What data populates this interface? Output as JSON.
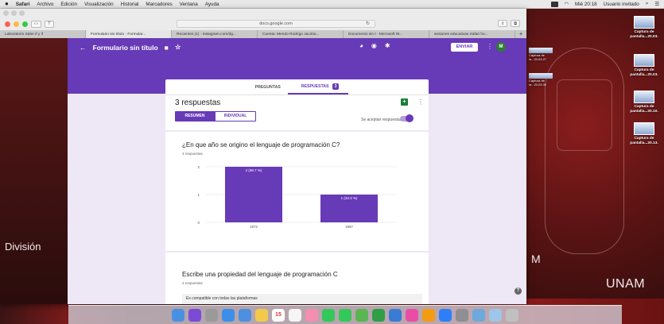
{
  "menubar": {
    "apple": "",
    "items": [
      "Safari",
      "Archivo",
      "Edición",
      "Visualización",
      "Historial",
      "Marcadores",
      "Ventana",
      "Ayuda"
    ],
    "clock": "Mié 20:18",
    "user": "Usuario invitado"
  },
  "background_window": {
    "tabs": [
      "Safari",
      "Archivo",
      "Edició"
    ]
  },
  "browser": {
    "url": "docs.google.com",
    "reload_icon": "reload-icon",
    "tabs": [
      "Laboratorio Sabe if y if",
      "Formulario sin título - Formular...",
      "Recientes (1) - instagram.com/dg...",
      "Cuenta: Mendo Rodrigo Jacinto...",
      "Documento sin t - Microsoft W...",
      "sesiones educativas Safari ho..."
    ]
  },
  "forms": {
    "title": "Formulario sin título",
    "send_label": "ENVIAR",
    "avatar_letter": "M",
    "tabs": {
      "questions": "PREGUNTAS",
      "responses": "RESPUESTAS",
      "responses_count": "3"
    },
    "responses_heading": "3 respuestas",
    "summary_label": "RESUMEN",
    "individual_label": "INDIVIDUAL",
    "accepting_label": "Se aceptan respuestas",
    "q1": {
      "title": "¿En que año se origino el lenguaje de programación C?",
      "subtitle": "3 respuestas"
    },
    "q2": {
      "title": "Escribe una propiedad del lenguaje de programación C",
      "subtitle": "3 respuestas",
      "answer_preview": "Es compatible con todas las plataformas"
    }
  },
  "chart_data": {
    "type": "bar",
    "categories": [
      "1972",
      "1987"
    ],
    "values": [
      2,
      1
    ],
    "data_labels": [
      "2 (66.7 %)",
      "1 (33.3 %)"
    ],
    "yticks": [
      "0",
      "1",
      "2"
    ],
    "ylim": [
      0,
      2
    ],
    "color": "#673ab7"
  },
  "desktop": {
    "left_text": "División",
    "right_text": "UNAM",
    "right_letter": "M",
    "files": [
      {
        "line1": "Captura de",
        "line2": "pantalla...20.03."
      },
      {
        "line1": "Captura de",
        "line2": "pantalla...20.03."
      },
      {
        "line1": "Captura de",
        "line2": "pantalla...20.10."
      },
      {
        "line1": "Captura de",
        "line2": "pantalla...20.13."
      }
    ],
    "small_files": [
      {
        "line1": "Captura de",
        "line2": "la...20.03.27"
      },
      {
        "line1": "Captura de",
        "line2": "la...20.03.30"
      }
    ]
  },
  "dock": {
    "icons": [
      "finder-icon",
      "siri-icon",
      "launchpad-icon",
      "safari-icon",
      "mail-icon",
      "notes-icon",
      "calendar-icon",
      "reminders-icon",
      "photos-icon",
      "messages-icon",
      "facetime-icon",
      "maps-icon",
      "numbers-icon",
      "keynote-icon",
      "itunes-icon",
      "ibooks-icon",
      "appstore-icon",
      "preferences-icon",
      "desktop-icon",
      "finder-folder-icon",
      "trash-icon"
    ],
    "calendar_day": "15"
  }
}
